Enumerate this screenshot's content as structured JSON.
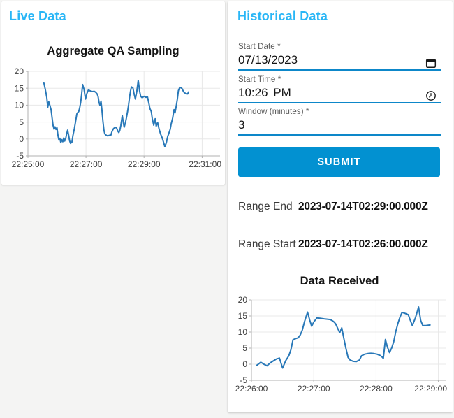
{
  "app": {
    "background": "#f4f4f3",
    "card_bg": "#ffffff",
    "accent_blue": "#29b6f6",
    "primary_blue": "#0291d1",
    "underline_blue": "#0d87c9"
  },
  "live_panel": {
    "title": "Live Data"
  },
  "historical_panel": {
    "title": "Historical Data",
    "fields": [
      {
        "label": "Start Date *",
        "value": "07/13/2023",
        "icon": "calendar-icon"
      },
      {
        "label": "Start Time *",
        "value": "10:26 PM",
        "icon": "clock-icon"
      },
      {
        "label": "Window (minutes) *",
        "value": "3",
        "icon": null
      }
    ],
    "submit_label": "SUBMIT",
    "range_end": {
      "label": "Range End",
      "value": "2023-07-14T02:29:00.000Z"
    },
    "range_start": {
      "label": "Range Start",
      "value": "2023-07-14T02:26:00.000Z"
    }
  },
  "chart_data": [
    {
      "type": "line",
      "title": "Aggregate QA Sampling",
      "xlabel": "",
      "ylabel": "",
      "x_tick_labels": [
        "22:25:00",
        "22:27:00",
        "22:29:00",
        "22:31:00"
      ],
      "x_tick_seconds": [
        0,
        120,
        240,
        360
      ],
      "x_domain_seconds": [
        0,
        397
      ],
      "ylim": [
        -5,
        20
      ],
      "y_ticks": [
        20,
        15,
        10,
        5,
        0,
        -5
      ],
      "grid": true,
      "legend": "none",
      "line_color": "#2878b8",
      "grid_color": "#e8e8e8",
      "axis_color": "#b0b0b0",
      "points": [
        [
          33,
          16.5
        ],
        [
          36,
          14.6
        ],
        [
          39,
          12.3
        ],
        [
          41,
          9.4
        ],
        [
          43,
          11.0
        ],
        [
          45,
          10.1
        ],
        [
          48,
          8.6
        ],
        [
          50,
          6.2
        ],
        [
          52,
          4.0
        ],
        [
          54,
          2.9
        ],
        [
          56,
          3.6
        ],
        [
          58,
          2.8
        ],
        [
          60,
          3.3
        ],
        [
          62,
          1.2
        ],
        [
          64,
          -0.3
        ],
        [
          66,
          0.2
        ],
        [
          68,
          -1.1
        ],
        [
          70,
          -0.2
        ],
        [
          72,
          -0.8
        ],
        [
          74,
          0.3
        ],
        [
          76,
          -0.6
        ],
        [
          78,
          0.1
        ],
        [
          80,
          1.4
        ],
        [
          82,
          2.6
        ],
        [
          84,
          1.2
        ],
        [
          86,
          -0.5
        ],
        [
          88,
          -1.3
        ],
        [
          91,
          -0.9
        ],
        [
          93,
          1.0
        ],
        [
          96,
          3.1
        ],
        [
          98,
          4.8
        ],
        [
          100,
          6.5
        ],
        [
          101,
          7.4
        ],
        [
          103,
          7.8
        ],
        [
          105,
          8.1
        ],
        [
          107,
          9.2
        ],
        [
          109,
          10.8
        ],
        [
          111,
          13.2
        ],
        [
          113,
          16.1
        ],
        [
          116,
          14.6
        ],
        [
          119,
          11.8
        ],
        [
          122,
          13.5
        ],
        [
          125,
          14.5
        ],
        [
          129,
          14.2
        ],
        [
          133,
          14.0
        ],
        [
          137,
          14.1
        ],
        [
          140,
          13.8
        ],
        [
          143,
          13.3
        ],
        [
          145,
          12.6
        ],
        [
          147,
          10.8
        ],
        [
          149,
          9.9
        ],
        [
          151,
          11.2
        ],
        [
          153,
          8.4
        ],
        [
          155,
          5.2
        ],
        [
          157,
          2.6
        ],
        [
          159,
          1.5
        ],
        [
          162,
          1.1
        ],
        [
          165,
          0.9
        ],
        [
          168,
          1.1
        ],
        [
          171,
          1.0
        ],
        [
          174,
          2.3
        ],
        [
          177,
          3.1
        ],
        [
          180,
          3.4
        ],
        [
          183,
          3.3
        ],
        [
          186,
          2.3
        ],
        [
          188,
          1.9
        ],
        [
          190,
          2.6
        ],
        [
          192,
          4.0
        ],
        [
          195,
          6.9
        ],
        [
          197,
          4.9
        ],
        [
          199,
          3.5
        ],
        [
          202,
          5.1
        ],
        [
          204,
          6.6
        ],
        [
          206,
          8.2
        ],
        [
          208,
          10.1
        ],
        [
          210,
          12.4
        ],
        [
          212,
          14.2
        ],
        [
          214,
          15.4
        ],
        [
          217,
          15.1
        ],
        [
          219,
          13.6
        ],
        [
          222,
          11.8
        ],
        [
          225,
          14.1
        ],
        [
          228,
          17.3
        ],
        [
          231,
          14.0
        ],
        [
          233,
          12.6
        ],
        [
          236,
          12.2
        ],
        [
          240,
          12.6
        ],
        [
          244,
          12.3
        ],
        [
          247,
          12.5
        ],
        [
          250,
          10.5
        ],
        [
          252,
          9.0
        ],
        [
          255,
          8.1
        ],
        [
          257,
          6.0
        ],
        [
          260,
          4.1
        ],
        [
          263,
          6.0
        ],
        [
          265,
          3.8
        ],
        [
          268,
          4.9
        ],
        [
          271,
          3.0
        ],
        [
          274,
          1.5
        ],
        [
          277,
          0.5
        ],
        [
          279,
          -0.4
        ],
        [
          283,
          -2.3
        ],
        [
          286,
          -1.1
        ],
        [
          289,
          0.8
        ],
        [
          291,
          1.6
        ],
        [
          294,
          2.9
        ],
        [
          296,
          4.4
        ],
        [
          299,
          6.1
        ],
        [
          302,
          8.7
        ],
        [
          304,
          7.7
        ],
        [
          307,
          10.2
        ],
        [
          309,
          11.9
        ],
        [
          311,
          14.3
        ],
        [
          314,
          15.3
        ],
        [
          318,
          15.0
        ],
        [
          322,
          13.9
        ],
        [
          326,
          13.4
        ],
        [
          330,
          13.3
        ],
        [
          332,
          13.9
        ]
      ]
    },
    {
      "type": "line",
      "title": "Data Received",
      "xlabel": "",
      "ylabel": "",
      "x_tick_labels": [
        "22:26:00",
        "22:27:00",
        "22:28:00",
        "22:29:00"
      ],
      "x_tick_seconds": [
        0,
        60,
        120,
        180
      ],
      "x_domain_seconds": [
        0,
        187
      ],
      "ylim": [
        -5,
        20
      ],
      "y_ticks": [
        20,
        15,
        10,
        5,
        0,
        -5
      ],
      "grid": true,
      "legend": "none",
      "line_color": "#2878b8",
      "grid_color": "#e8e8e8",
      "axis_color": "#b0b0b0",
      "points": [
        [
          5,
          -0.4
        ],
        [
          9,
          0.6
        ],
        [
          12,
          0.0
        ],
        [
          15,
          -0.5
        ],
        [
          18,
          0.4
        ],
        [
          21,
          1.0
        ],
        [
          24,
          1.6
        ],
        [
          27,
          1.9
        ],
        [
          30,
          -1.2
        ],
        [
          33,
          1.1
        ],
        [
          36,
          2.6
        ],
        [
          38,
          4.5
        ],
        [
          40,
          7.6
        ],
        [
          43,
          8.0
        ],
        [
          45,
          8.2
        ],
        [
          47,
          9.1
        ],
        [
          49,
          10.6
        ],
        [
          51,
          13.1
        ],
        [
          54,
          16.2
        ],
        [
          56,
          13.8
        ],
        [
          58,
          11.8
        ],
        [
          60,
          13.1
        ],
        [
          63,
          14.4
        ],
        [
          66,
          14.3
        ],
        [
          70,
          14.1
        ],
        [
          73,
          14.0
        ],
        [
          76,
          13.9
        ],
        [
          79,
          13.3
        ],
        [
          81,
          12.6
        ],
        [
          83,
          11.2
        ],
        [
          85,
          9.8
        ],
        [
          87,
          11.3
        ],
        [
          89,
          8.0
        ],
        [
          91,
          4.9
        ],
        [
          93,
          2.1
        ],
        [
          95,
          1.3
        ],
        [
          98,
          0.9
        ],
        [
          101,
          0.8
        ],
        [
          104,
          1.3
        ],
        [
          106,
          2.6
        ],
        [
          109,
          3.1
        ],
        [
          112,
          3.3
        ],
        [
          115,
          3.4
        ],
        [
          118,
          3.3
        ],
        [
          121,
          3.1
        ],
        [
          124,
          2.7
        ],
        [
          126,
          2.2
        ],
        [
          127,
          1.8
        ],
        [
          129,
          7.7
        ],
        [
          131,
          5.3
        ],
        [
          133,
          3.6
        ],
        [
          135,
          5.0
        ],
        [
          137,
          7.0
        ],
        [
          139,
          10.1
        ],
        [
          141,
          12.6
        ],
        [
          143,
          14.6
        ],
        [
          145,
          16.1
        ],
        [
          148,
          15.8
        ],
        [
          151,
          15.4
        ],
        [
          153,
          13.6
        ],
        [
          155,
          12.0
        ],
        [
          158,
          14.5
        ],
        [
          161,
          17.8
        ],
        [
          163,
          13.6
        ],
        [
          165,
          12.0
        ],
        [
          168,
          12.0
        ],
        [
          172,
          12.2
        ]
      ]
    }
  ]
}
